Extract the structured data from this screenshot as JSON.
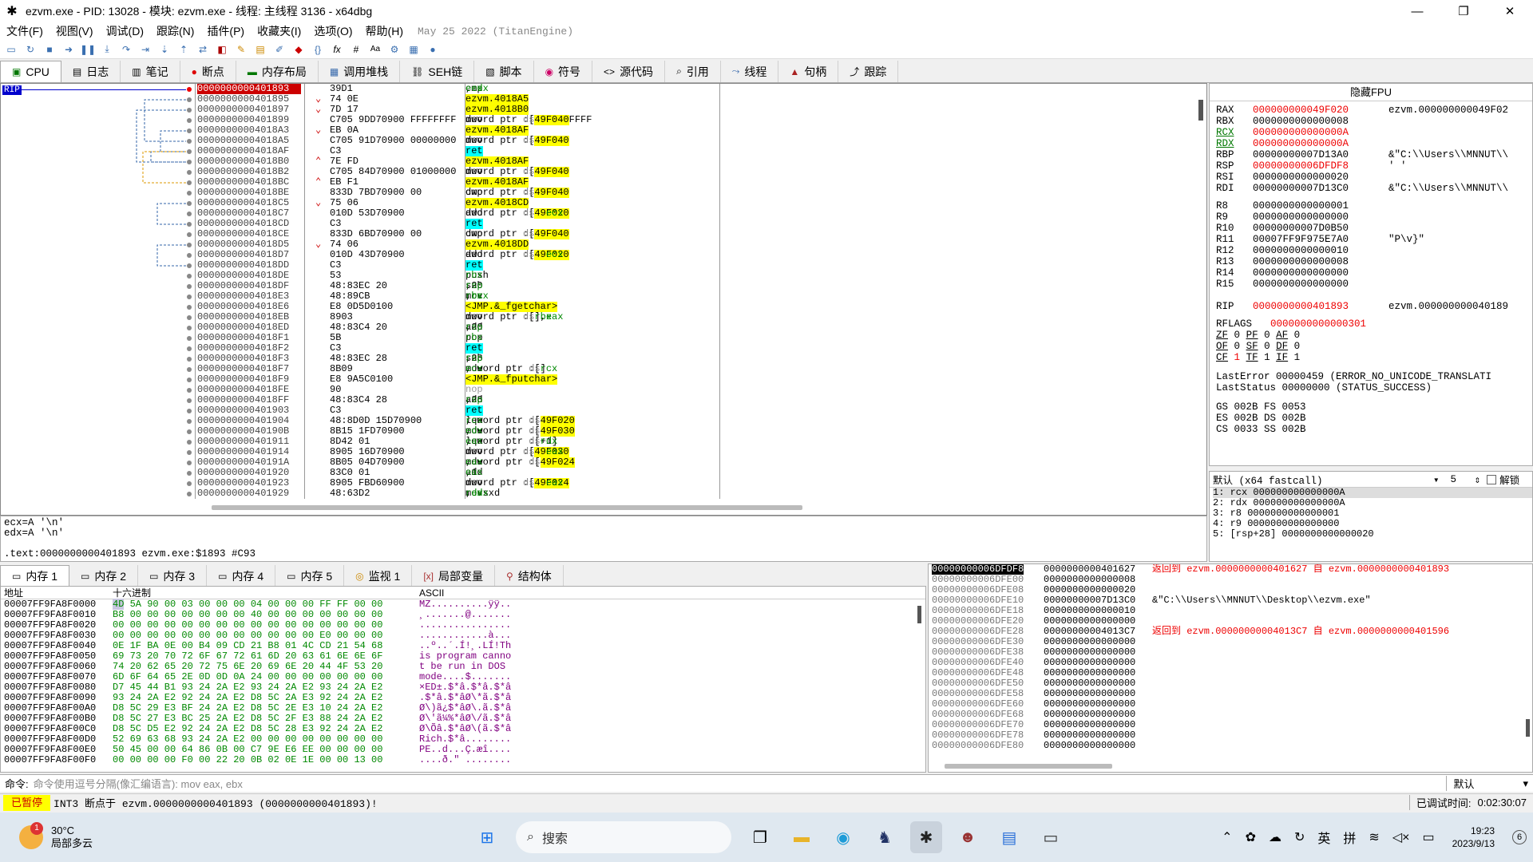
{
  "window": {
    "title": "ezvm.exe - PID: 13028 - 模块: ezvm.exe - 线程: 主线程 3136 - x64dbg",
    "minimize": "—",
    "maximize": "❐",
    "close": "✕"
  },
  "menu": {
    "items": [
      "文件(F)",
      "视图(V)",
      "调试(D)",
      "跟踪(N)",
      "插件(P)",
      "收藏夹(I)",
      "选项(O)",
      "帮助(H)"
    ],
    "build_date": "May 25 2022 (TitanEngine)"
  },
  "toolbar": {
    "icons": [
      "open-icon",
      "restart-icon",
      "stop-icon",
      "run-icon",
      "pause-icon",
      "step-into-icon",
      "step-over-icon",
      "trace-into-icon",
      "trace-over-icon",
      "execute-till-return-icon",
      "run-to-user-icon",
      "scylla-icon",
      "patch-icon",
      "comment-icon",
      "label-icon",
      "bookmark-icon",
      "function-icon",
      "fx-icon",
      "hash-icon",
      "font-icon",
      "settings-icon",
      "calc-icon",
      "help-icon"
    ],
    "fx_label": "fx",
    "hash_label": "#",
    "font_label": "Aa"
  },
  "tabs": [
    {
      "label": "CPU",
      "icon": "cpu-icon",
      "selected": true
    },
    {
      "label": "日志",
      "icon": "log-icon"
    },
    {
      "label": "笔记",
      "icon": "notes-icon"
    },
    {
      "label": "断点",
      "icon": "breakpoint-icon"
    },
    {
      "label": "内存布局",
      "icon": "memory-map-icon"
    },
    {
      "label": "调用堆栈",
      "icon": "call-stack-icon"
    },
    {
      "label": "SEH链",
      "icon": "seh-icon"
    },
    {
      "label": "脚本",
      "icon": "script-icon"
    },
    {
      "label": "符号",
      "icon": "symbols-icon"
    },
    {
      "label": "源代码",
      "icon": "source-icon"
    },
    {
      "label": "引用",
      "icon": "references-icon"
    },
    {
      "label": "线程",
      "icon": "threads-icon"
    },
    {
      "label": "句柄",
      "icon": "handles-icon"
    },
    {
      "label": "跟踪",
      "icon": "trace-icon"
    }
  ],
  "disasm": {
    "rip_label": "RIP",
    "rows": [
      {
        "addr": "0000000000401893",
        "arrow": "",
        "bytes": "39D1",
        "ins": "cmp ecx,edx",
        "kind": "plain",
        "selected": true
      },
      {
        "addr": "0000000000401895",
        "arrow": "v",
        "bytes": "74 0E",
        "ins": "je ezvm.4018A5",
        "kind": "jcc"
      },
      {
        "addr": "0000000000401897",
        "arrow": "v",
        "bytes": "7D 17",
        "ins": "jge ezvm.4018B0",
        "kind": "jcc"
      },
      {
        "addr": "0000000000401899",
        "arrow": "",
        "bytes": "C705 9DD70900 FFFFFFFF",
        "ins": "mov dword ptr ds:[49F040],FFFFFFFF",
        "kind": "plain"
      },
      {
        "addr": "00000000004018A3",
        "arrow": "v",
        "bytes": "EB 0A",
        "ins": "jmp ezvm.4018AF",
        "kind": "jmp"
      },
      {
        "addr": "00000000004018A5",
        "arrow": "",
        "bytes": "C705 91D70900 00000000",
        "ins": "mov dword ptr ds:[49F040],0",
        "kind": "plain"
      },
      {
        "addr": "00000000004018AF",
        "arrow": "",
        "bytes": "C3",
        "ins": "ret",
        "kind": "ret"
      },
      {
        "addr": "00000000004018B0",
        "arrow": "^",
        "bytes": "7E FD",
        "ins": "jle ezvm.4018AF",
        "kind": "jcc"
      },
      {
        "addr": "00000000004018B2",
        "arrow": "",
        "bytes": "C705 84D70900 01000000",
        "ins": "mov dword ptr ds:[49F040],1",
        "kind": "plain"
      },
      {
        "addr": "00000000004018BC",
        "arrow": "^",
        "bytes": "EB F1",
        "ins": "jmp ezvm.4018AF",
        "kind": "jmp"
      },
      {
        "addr": "00000000004018BE",
        "arrow": "",
        "bytes": "833D 7BD70900 00",
        "ins": "cmp dword ptr ds:[49F040],0",
        "kind": "plain"
      },
      {
        "addr": "00000000004018C5",
        "arrow": "v",
        "bytes": "75 06",
        "ins": "jne ezvm.4018CD",
        "kind": "jcc"
      },
      {
        "addr": "00000000004018C7",
        "arrow": "",
        "bytes": "010D 53D70900",
        "ins": "add dword ptr ds:[49F020],ecx",
        "kind": "plain"
      },
      {
        "addr": "00000000004018CD",
        "arrow": "",
        "bytes": "C3",
        "ins": "ret",
        "kind": "ret"
      },
      {
        "addr": "00000000004018CE",
        "arrow": "",
        "bytes": "833D 6BD70900 00",
        "ins": "cmp dword ptr ds:[49F040],0",
        "kind": "plain"
      },
      {
        "addr": "00000000004018D5",
        "arrow": "v",
        "bytes": "74 06",
        "ins": "je ezvm.4018DD",
        "kind": "jcc"
      },
      {
        "addr": "00000000004018D7",
        "arrow": "",
        "bytes": "010D 43D70900",
        "ins": "add dword ptr ds:[49F020],ecx",
        "kind": "plain"
      },
      {
        "addr": "00000000004018DD",
        "arrow": "",
        "bytes": "C3",
        "ins": "ret",
        "kind": "ret"
      },
      {
        "addr": "00000000004018DE",
        "arrow": "",
        "bytes": "53",
        "ins": "push rbx",
        "kind": "plain"
      },
      {
        "addr": "00000000004018DF",
        "arrow": "",
        "bytes": "48:83EC 20",
        "ins": "sub rsp,20",
        "kind": "plain"
      },
      {
        "addr": "00000000004018E3",
        "arrow": "",
        "bytes": "48:89CB",
        "ins": "mov rbx,rcx",
        "kind": "plain"
      },
      {
        "addr": "00000000004018E6",
        "arrow": "",
        "bytes": "E8 0D5D0100",
        "ins": "call <JMP.&_fgetchar>",
        "kind": "call"
      },
      {
        "addr": "00000000004018EB",
        "arrow": "",
        "bytes": "8903",
        "ins": "mov dword ptr ds:[rbx],eax",
        "kind": "plain"
      },
      {
        "addr": "00000000004018ED",
        "arrow": "",
        "bytes": "48:83C4 20",
        "ins": "add rsp,20",
        "kind": "plain"
      },
      {
        "addr": "00000000004018F1",
        "arrow": "",
        "bytes": "5B",
        "ins": "pop rbx",
        "kind": "plain"
      },
      {
        "addr": "00000000004018F2",
        "arrow": "",
        "bytes": "C3",
        "ins": "ret",
        "kind": "ret"
      },
      {
        "addr": "00000000004018F3",
        "arrow": "",
        "bytes": "48:83EC 28",
        "ins": "sub rsp,28",
        "kind": "plain"
      },
      {
        "addr": "00000000004018F7",
        "arrow": "",
        "bytes": "8B09",
        "ins": "mov ecx,dword ptr ds:[rcx]",
        "kind": "plain"
      },
      {
        "addr": "00000000004018F9",
        "arrow": "",
        "bytes": "E8 9A5C0100",
        "ins": "call <JMP.&_fputchar>",
        "kind": "call"
      },
      {
        "addr": "00000000004018FE",
        "arrow": "",
        "bytes": "90",
        "ins": "nop",
        "kind": "nop"
      },
      {
        "addr": "00000000004018FF",
        "arrow": "",
        "bytes": "48:83C4 28",
        "ins": "add rsp,28",
        "kind": "plain"
      },
      {
        "addr": "0000000000401903",
        "arrow": "",
        "bytes": "C3",
        "ins": "ret",
        "kind": "ret"
      },
      {
        "addr": "0000000000401904",
        "arrow": "",
        "bytes": "48:8D0D 15D70900",
        "ins": "lea rcx,qword ptr ds:[49F020]",
        "kind": "plain"
      },
      {
        "addr": "000000000040190B",
        "arrow": "",
        "bytes": "8B15 1FD70900",
        "ins": "mov edx,dword ptr ds:[49F030]",
        "kind": "plain"
      },
      {
        "addr": "0000000000401911",
        "arrow": "",
        "bytes": "8D42 01",
        "ins": "lea eax,qword ptr ds:[rdx+1]",
        "kind": "plain"
      },
      {
        "addr": "0000000000401914",
        "arrow": "",
        "bytes": "8905 16D70900",
        "ins": "mov dword ptr ds:[49F030],eax",
        "kind": "plain"
      },
      {
        "addr": "000000000040191A",
        "arrow": "",
        "bytes": "8B05 04D70900",
        "ins": "mov eax,dword ptr ds:[49F024]",
        "kind": "plain"
      },
      {
        "addr": "0000000000401920",
        "arrow": "",
        "bytes": "83C0 01",
        "ins": "add eax,1",
        "kind": "plain"
      },
      {
        "addr": "0000000000401923",
        "arrow": "",
        "bytes": "8905 FBD60900",
        "ins": "mov dword ptr ds:[49F024],eax",
        "kind": "plain"
      },
      {
        "addr": "0000000000401929",
        "arrow": "",
        "bytes": "48:63D2",
        "ins": "movsxd rdx,edx",
        "kind": "plain"
      }
    ]
  },
  "registers": {
    "header": "隐藏FPU",
    "gp": [
      {
        "name": "RAX",
        "value": "000000000049F020",
        "changed": true,
        "comment": "ezvm.000000000049F02"
      },
      {
        "name": "RBX",
        "value": "0000000000000008",
        "comment": ""
      },
      {
        "name": "RCX",
        "value": "000000000000000A",
        "changed": true,
        "comment": ""
      },
      {
        "name": "RDX",
        "value": "000000000000000A",
        "changed": true,
        "comment": ""
      },
      {
        "name": "RBP",
        "value": "00000000007D13A0",
        "comment": "&\"C:\\\\Users\\\\MNNUT\\\\"
      },
      {
        "name": "RSP",
        "value": "00000000006DFDF8",
        "changed": true,
        "comment": "' '"
      },
      {
        "name": "RSI",
        "value": "0000000000000020",
        "comment": ""
      },
      {
        "name": "RDI",
        "value": "00000000007D13C0",
        "comment": "&\"C:\\\\Users\\\\MNNUT\\\\"
      }
    ],
    "ext": [
      {
        "name": "R8",
        "value": "0000000000000001",
        "comment": ""
      },
      {
        "name": "R9",
        "value": "0000000000000000",
        "comment": ""
      },
      {
        "name": "R10",
        "value": "00000000007D0B50",
        "comment": ""
      },
      {
        "name": "R11",
        "value": "00007FF9F975E7A0",
        "comment": "\"P\\v}\""
      },
      {
        "name": "R12",
        "value": "0000000000000010",
        "comment": ""
      },
      {
        "name": "R13",
        "value": "0000000000000008",
        "comment": ""
      },
      {
        "name": "R14",
        "value": "0000000000000000",
        "comment": ""
      },
      {
        "name": "R15",
        "value": "0000000000000000",
        "comment": ""
      }
    ],
    "rip": {
      "name": "RIP",
      "value": "0000000000401893",
      "comment": "ezvm.000000000040189"
    },
    "rflags": {
      "name": "RFLAGS",
      "value": "0000000000000301"
    },
    "flags": [
      [
        "ZF",
        "0",
        "PF",
        "0",
        "AF",
        "0"
      ],
      [
        "OF",
        "0",
        "SF",
        "0",
        "DF",
        "0"
      ],
      [
        "CF",
        "1",
        "TF",
        "1",
        "IF",
        "1"
      ]
    ],
    "last_error": "LastError  00000459 (ERROR_NO_UNICODE_TRANSLATI",
    "last_status": "LastStatus 00000000 (STATUS_SUCCESS)",
    "segs": [
      "GS 002B  FS 0053",
      "ES 002B  DS 002B",
      "CS 0033  SS 002B"
    ]
  },
  "callconv": {
    "label": "默认 (x64 fastcall)",
    "count": "5",
    "unlock": "解锁",
    "args": [
      "1: rcx 000000000000000A",
      "2: rdx 000000000000000A",
      "3: r8 0000000000000001",
      "4: r9 0000000000000000",
      "5: [rsp+28] 0000000000000020"
    ]
  },
  "info": {
    "lines": [
      "ecx=A '\\n'",
      "edx=A '\\n'",
      "",
      ".text:0000000000401893 ezvm.exe:$1893 #C93"
    ]
  },
  "dump_tabs": [
    {
      "label": "内存 1",
      "icon": "memory-icon",
      "selected": true
    },
    {
      "label": "内存 2",
      "icon": "memory-icon"
    },
    {
      "label": "内存 3",
      "icon": "memory-icon"
    },
    {
      "label": "内存 4",
      "icon": "memory-icon"
    },
    {
      "label": "内存 5",
      "icon": "memory-icon"
    },
    {
      "label": "监视 1",
      "icon": "watch-icon"
    },
    {
      "label": "局部变量",
      "icon": "locals-icon"
    },
    {
      "label": "结构体",
      "icon": "struct-icon"
    }
  ],
  "dump": {
    "col_addr": "地址",
    "col_hex": "十六进制",
    "col_ascii": "ASCII",
    "rows": [
      {
        "a": "00007FF9FA8F0000",
        "h": "4D 5A 90 00 03 00 00 00 04 00 00 00 FF FF 00 00",
        "x": "MZ..........ÿÿ.."
      },
      {
        "a": "00007FF9FA8F0010",
        "h": "B8 00 00 00 00 00 00 00 40 00 00 00 00 00 00 00",
        "x": "¸.......@......."
      },
      {
        "a": "00007FF9FA8F0020",
        "h": "00 00 00 00 00 00 00 00 00 00 00 00 00 00 00 00",
        "x": "................"
      },
      {
        "a": "00007FF9FA8F0030",
        "h": "00 00 00 00 00 00 00 00 00 00 00 00 E0 00 00 00",
        "x": "............à..."
      },
      {
        "a": "00007FF9FA8F0040",
        "h": "0E 1F BA 0E 00 B4 09 CD 21 B8 01 4C CD 21 54 68",
        "x": "..º..´.Í!¸.LÍ!Th"
      },
      {
        "a": "00007FF9FA8F0050",
        "h": "69 73 20 70 72 6F 67 72 61 6D 20 63 61 6E 6E 6F",
        "x": "is program canno"
      },
      {
        "a": "00007FF9FA8F0060",
        "h": "74 20 62 65 20 72 75 6E 20 69 6E 20 44 4F 53 20",
        "x": "t be run in DOS "
      },
      {
        "a": "00007FF9FA8F0070",
        "h": "6D 6F 64 65 2E 0D 0D 0A 24 00 00 00 00 00 00 00",
        "x": "mode....$......."
      },
      {
        "a": "00007FF9FA8F0080",
        "h": "D7 45 44 B1 93 24 2A E2 93 24 2A E2 93 24 2A E2",
        "x": "×ED±.$*â.$*â.$*â"
      },
      {
        "a": "00007FF9FA8F0090",
        "h": "93 24 2A E2 92 24 2A E2 D8 5C 2A E3 92 24 2A E2",
        "x": ".$*â.$*âØ\\*ã.$*â"
      },
      {
        "a": "00007FF9FA8F00A0",
        "h": "D8 5C 29 E3 BF 24 2A E2 D8 5C 2E E3 10 24 2A E2",
        "x": "Ø\\)ã¿$*âØ\\.ã.$*â"
      },
      {
        "a": "00007FF9FA8F00B0",
        "h": "D8 5C 27 E3 BC 25 2A E2 D8 5C 2F E3 88 24 2A E2",
        "x": "Ø\\'ã¼%*âØ\\/ã.$*â"
      },
      {
        "a": "00007FF9FA8F00C0",
        "h": "D8 5C D5 E2 92 24 2A E2 D8 5C 28 E3 92 24 2A E2",
        "x": "Ø\\Õâ.$*âØ\\(ã.$*â"
      },
      {
        "a": "00007FF9FA8F00D0",
        "h": "52 69 63 68 93 24 2A E2 00 00 00 00 00 00 00 00",
        "x": "Rich.$*â........"
      },
      {
        "a": "00007FF9FA8F00E0",
        "h": "50 45 00 00 64 86 0B 00 C7 9E E6 EE 00 00 00 00",
        "x": "PE..d...Ç.æî...."
      },
      {
        "a": "00007FF9FA8F00F0",
        "h": "00 00 00 00 F0 00 22 20 0B 02 0E 1E 00 00 13 00",
        "x": "....ð.\" ........"
      }
    ]
  },
  "stack": {
    "rows": [
      {
        "a": "00000000006DFDF8",
        "v": "0000000000401627",
        "c": "返回到 ezvm.0000000000401627 自 ezvm.0000000000401893",
        "ret": true,
        "sel": true
      },
      {
        "a": "00000000006DFE00",
        "v": "0000000000000008",
        "c": ""
      },
      {
        "a": "00000000006DFE08",
        "v": "0000000000000020",
        "c": ""
      },
      {
        "a": "00000000006DFE10",
        "v": "00000000007D13C0",
        "c": "&\"C:\\\\Users\\\\MNNUT\\\\Desktop\\\\ezvm.exe\""
      },
      {
        "a": "00000000006DFE18",
        "v": "0000000000000010",
        "c": ""
      },
      {
        "a": "00000000006DFE20",
        "v": "0000000000000000",
        "c": ""
      },
      {
        "a": "00000000006DFE28",
        "v": "00000000004013C7",
        "c": "返回到 ezvm.00000000004013C7 自 ezvm.0000000000401596",
        "ret": true
      },
      {
        "a": "00000000006DFE30",
        "v": "0000000000000000",
        "c": ""
      },
      {
        "a": "00000000006DFE38",
        "v": "0000000000000000",
        "c": ""
      },
      {
        "a": "00000000006DFE40",
        "v": "0000000000000000",
        "c": ""
      },
      {
        "a": "00000000006DFE48",
        "v": "0000000000000000",
        "c": ""
      },
      {
        "a": "00000000006DFE50",
        "v": "0000000000000000",
        "c": ""
      },
      {
        "a": "00000000006DFE58",
        "v": "0000000000000000",
        "c": ""
      },
      {
        "a": "00000000006DFE60",
        "v": "0000000000000000",
        "c": ""
      },
      {
        "a": "00000000006DFE68",
        "v": "0000000000000000",
        "c": ""
      },
      {
        "a": "00000000006DFE70",
        "v": "0000000000000000",
        "c": ""
      },
      {
        "a": "00000000006DFE78",
        "v": "0000000000000000",
        "c": ""
      },
      {
        "a": "00000000006DFE80",
        "v": "0000000000000000",
        "c": ""
      }
    ]
  },
  "command": {
    "label": "命令:",
    "placeholder": "命令使用逗号分隔(像汇编语言): mov eax, ebx",
    "default": "默认"
  },
  "status": {
    "state": "已暂停",
    "message": "INT3 断点于 ezvm.0000000000401893 (0000000000401893)!",
    "time_label": "已调试时间:",
    "time": "0:02:30:07"
  },
  "taskbar": {
    "weather_temp": "30°C",
    "weather_desc": "局部多云",
    "weather_badge": "1",
    "search": "搜索",
    "lang": "英",
    "ime": "拼",
    "time": "19:23",
    "date": "2023/9/13",
    "notif": "6"
  }
}
